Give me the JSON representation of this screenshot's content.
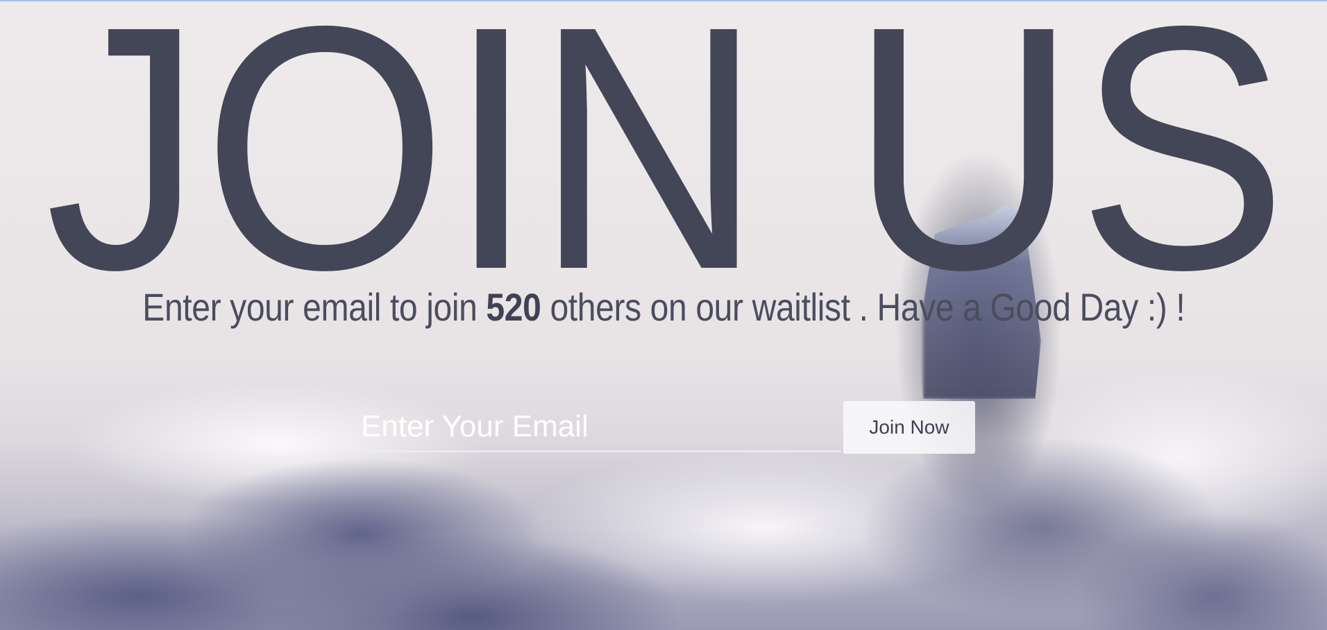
{
  "hero": {
    "heading": "JOIN US",
    "subtitle_before": "Enter your email to join ",
    "count": "520",
    "subtitle_after": " others on our waitlist . Have a Good Day :) !"
  },
  "form": {
    "email_placeholder": "Enter Your Email",
    "email_value": "",
    "submit_label": "Join Now"
  },
  "colors": {
    "heading": "#434656",
    "text": "#4b4d5e",
    "input_text": "#ffffff"
  }
}
